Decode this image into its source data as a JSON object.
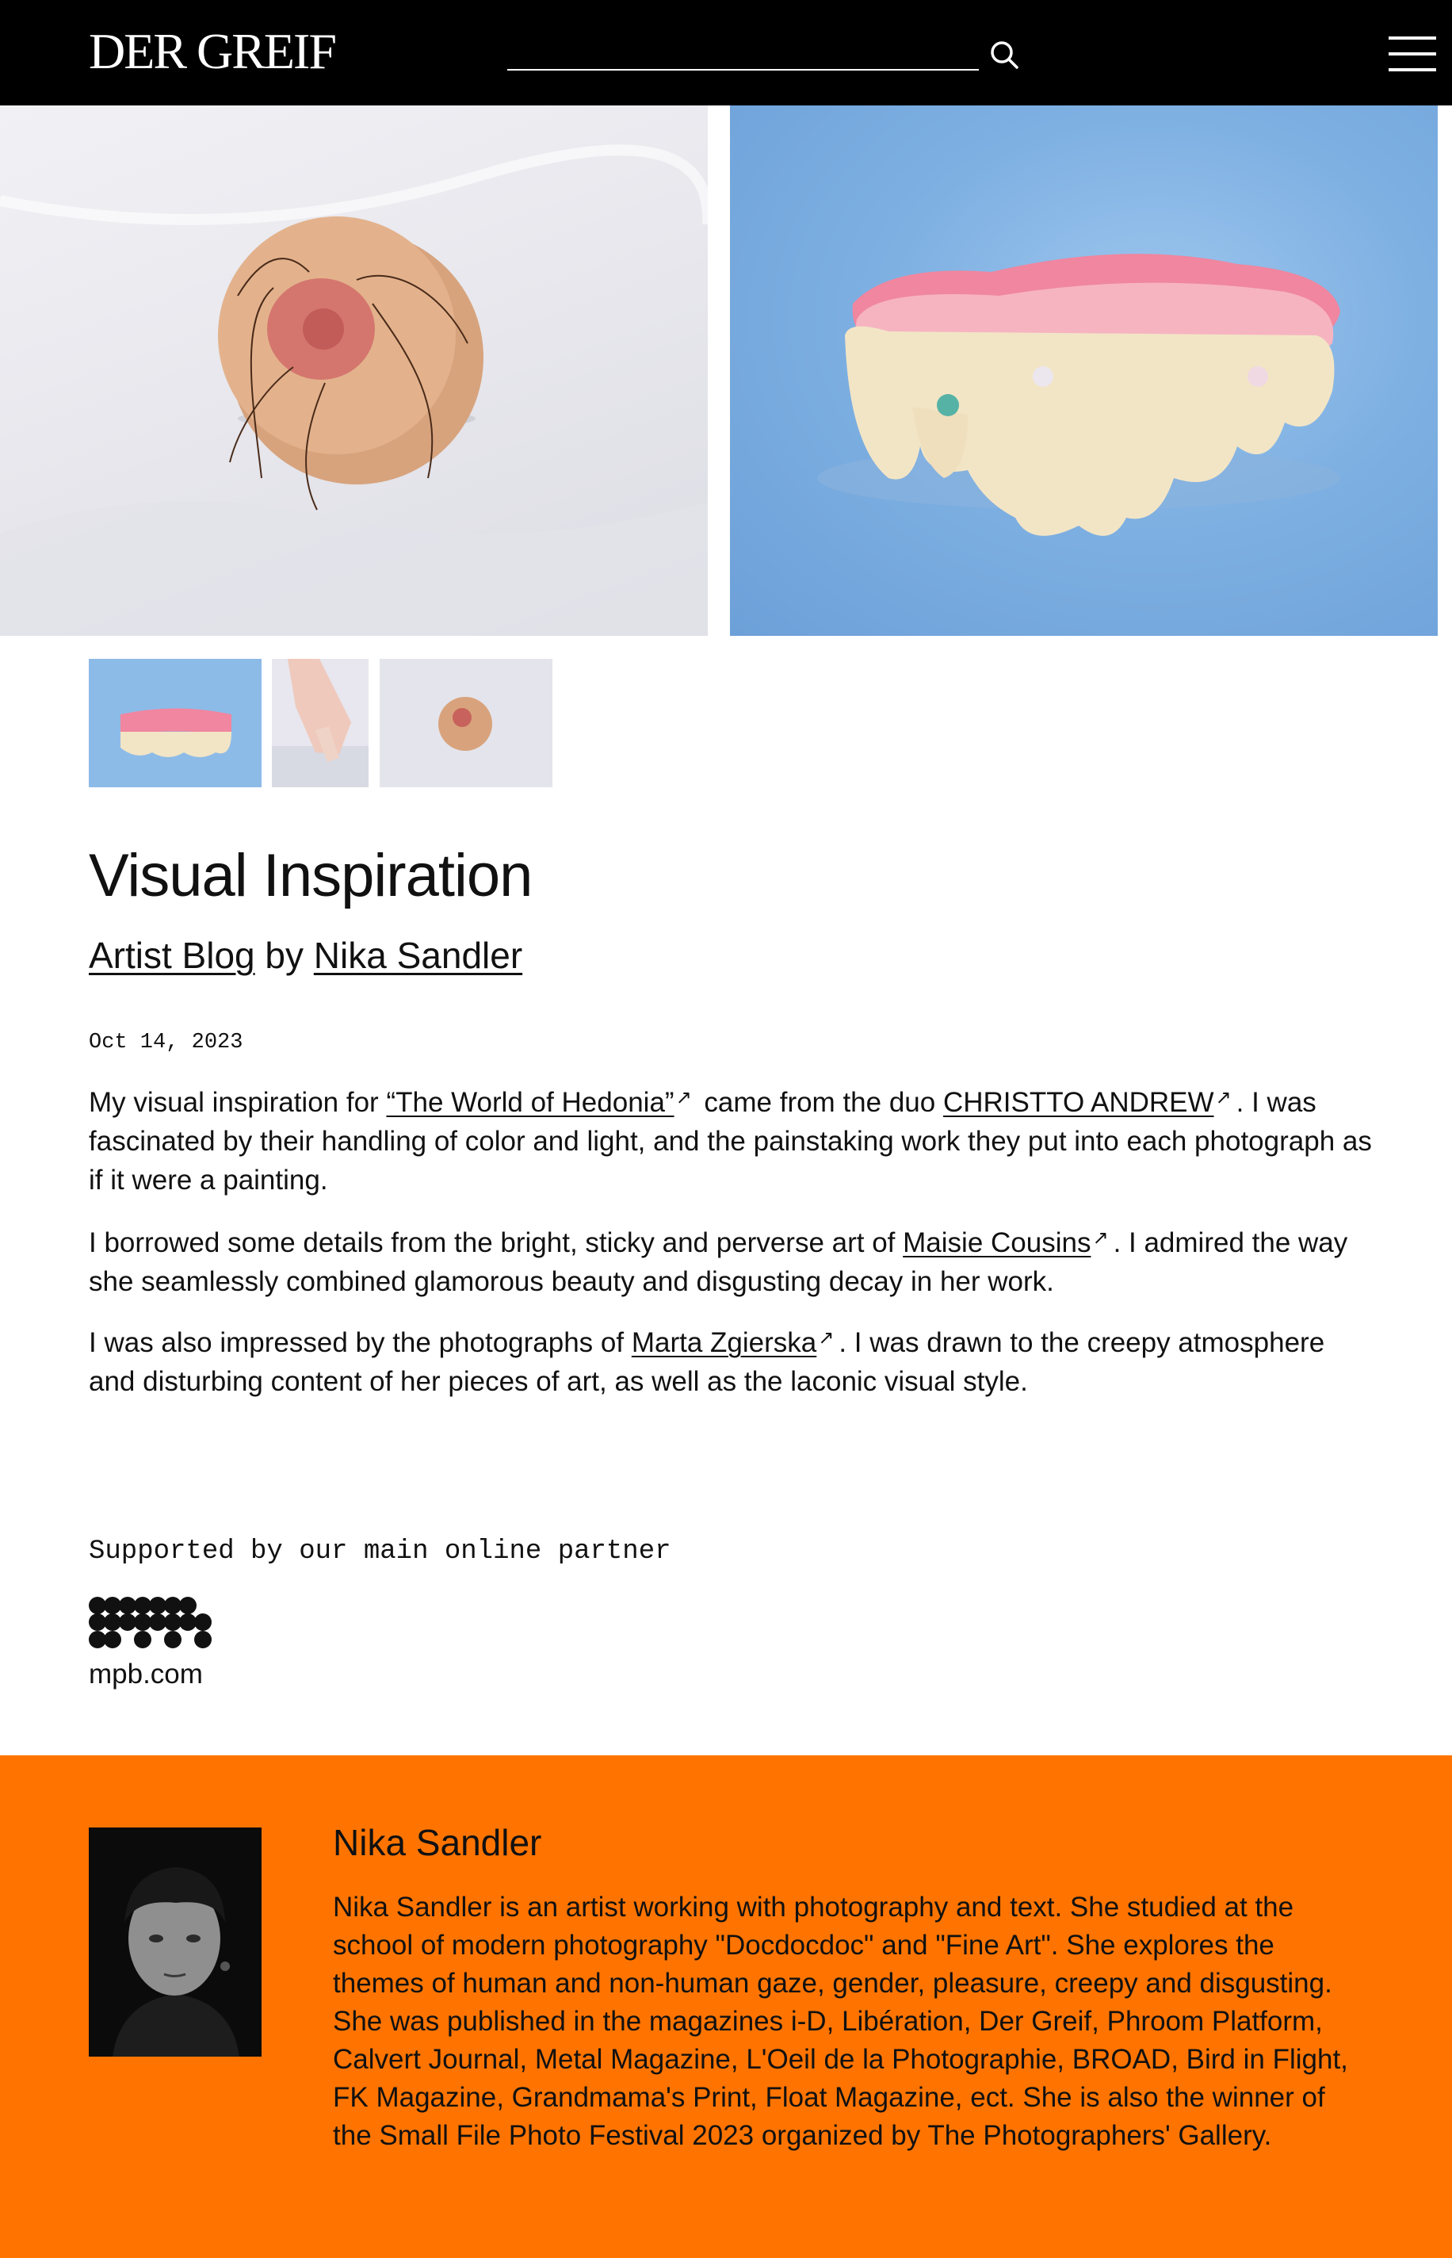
{
  "header": {
    "logo": "DER GREIF",
    "search_placeholder": ""
  },
  "gallery": {
    "slides": [
      {
        "alt": "Prosthetic breast with cracked nipple and hairs on white fabric"
      },
      {
        "alt": "Pink gummy teeth with pearls on blue background"
      }
    ],
    "thumbnails": [
      {
        "alt": "Gummy teeth"
      },
      {
        "alt": "Hand with nails on sparkly surface"
      },
      {
        "alt": "Prosthetic breast"
      }
    ]
  },
  "article": {
    "title": "Visual Inspiration",
    "byline": {
      "category": "Artist Blog",
      "by": "by",
      "author": "Nika Sandler"
    },
    "date": "Oct 14, 2023",
    "paragraphs": {
      "p1": {
        "t1": "My visual inspiration for",
        "link1": "“The World of Hedonia”",
        "t2": "came from the duo",
        "link2": "CHRISTTO ANDREW",
        "t3": ". I was fascinated by their handling of color and light, and the painstaking work they put into each photograph as if it were a painting."
      },
      "p2": {
        "t1": "I borrowed some details from the bright, sticky and perverse art of",
        "link1": "Maisie Cousins",
        "t2": ". I admired the way she seamlessly combined glamorous beauty and disgusting decay in her work."
      },
      "p3": {
        "t1": "I was also impressed by the photographs of",
        "link1": "Marta Zgierska",
        "t2": ". I was drawn to the creepy atmosphere and disturbing content of her pieces of art, as well as the laconic visual style."
      }
    },
    "external_link_symbol": "↗"
  },
  "partner": {
    "label": "Supported by our main online partner",
    "url": "mpb.com"
  },
  "author_box": {
    "name": "Nika Sandler",
    "bio": "Nika Sandler is an artist working with photography and text. She studied at the school of modern photography \"Docdocdoc\" and \"Fine Art\". She explores the themes of human and non-human gaze, gender, pleasure, creepy and disgusting. She was published in the magazines i-D, Libération, Der Greif, Phroom Platform, Calvert Journal, Metal Magazine, L'Oeil de la Photographie, BROAD, Bird in Flight, FK Magazine, Grandmama's Print, Float Magazine, ect. She is also the winner of the Small File Photo Festival 2023 organized by The Photographers' Gallery."
  },
  "colors": {
    "header_bg": "#000000",
    "author_bg": "#ff7400",
    "text": "#111111"
  }
}
